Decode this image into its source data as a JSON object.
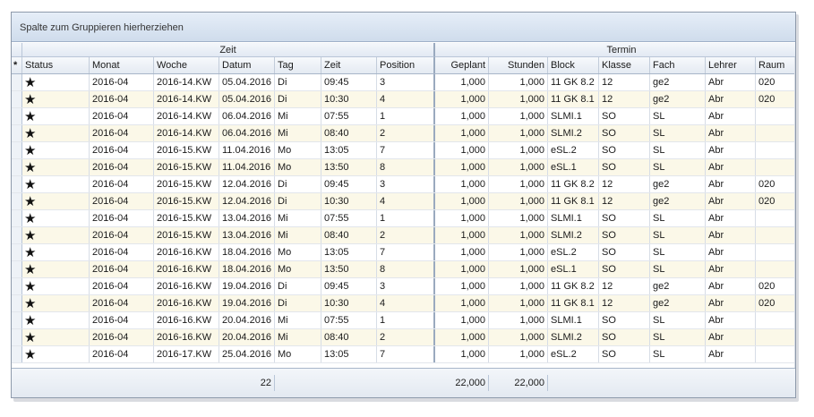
{
  "group_panel": {
    "hint": "Spalte zum Gruppieren hierherziehen"
  },
  "bands": {
    "zeit": "Zeit",
    "termin": "Termin"
  },
  "columns": {
    "indicator": "*",
    "status": "Status",
    "monat": "Monat",
    "woche": "Woche",
    "datum": "Datum",
    "tag": "Tag",
    "zeit": "Zeit",
    "position": "Position",
    "geplant": "Geplant",
    "stunden": "Stunden",
    "block": "Block",
    "klasse": "Klasse",
    "fach": "Fach",
    "lehrer": "Lehrer",
    "raum": "Raum"
  },
  "status_icon": "star-icon",
  "rows": [
    {
      "status": "★",
      "monat": "2016-04",
      "woche": "2016-14.KW",
      "datum": "05.04.2016",
      "tag": "Di",
      "zeit": "09:45",
      "position": "3",
      "geplant": "1,000",
      "stunden": "1,000",
      "block": "11 GK 8.2",
      "klasse": "12",
      "fach": "ge2",
      "lehrer": "Abr",
      "raum": "020"
    },
    {
      "status": "★",
      "monat": "2016-04",
      "woche": "2016-14.KW",
      "datum": "05.04.2016",
      "tag": "Di",
      "zeit": "10:30",
      "position": "4",
      "geplant": "1,000",
      "stunden": "1,000",
      "block": "11 GK 8.1",
      "klasse": "12",
      "fach": "ge2",
      "lehrer": "Abr",
      "raum": "020"
    },
    {
      "status": "★",
      "monat": "2016-04",
      "woche": "2016-14.KW",
      "datum": "06.04.2016",
      "tag": "Mi",
      "zeit": "07:55",
      "position": "1",
      "geplant": "1,000",
      "stunden": "1,000",
      "block": "SLMI.1",
      "klasse": "SO",
      "fach": "SL",
      "lehrer": "Abr",
      "raum": ""
    },
    {
      "status": "★",
      "monat": "2016-04",
      "woche": "2016-14.KW",
      "datum": "06.04.2016",
      "tag": "Mi",
      "zeit": "08:40",
      "position": "2",
      "geplant": "1,000",
      "stunden": "1,000",
      "block": "SLMI.2",
      "klasse": "SO",
      "fach": "SL",
      "lehrer": "Abr",
      "raum": ""
    },
    {
      "status": "★",
      "monat": "2016-04",
      "woche": "2016-15.KW",
      "datum": "11.04.2016",
      "tag": "Mo",
      "zeit": "13:05",
      "position": "7",
      "geplant": "1,000",
      "stunden": "1,000",
      "block": "eSL.2",
      "klasse": "SO",
      "fach": "SL",
      "lehrer": "Abr",
      "raum": ""
    },
    {
      "status": "★",
      "monat": "2016-04",
      "woche": "2016-15.KW",
      "datum": "11.04.2016",
      "tag": "Mo",
      "zeit": "13:50",
      "position": "8",
      "geplant": "1,000",
      "stunden": "1,000",
      "block": "eSL.1",
      "klasse": "SO",
      "fach": "SL",
      "lehrer": "Abr",
      "raum": ""
    },
    {
      "status": "★",
      "monat": "2016-04",
      "woche": "2016-15.KW",
      "datum": "12.04.2016",
      "tag": "Di",
      "zeit": "09:45",
      "position": "3",
      "geplant": "1,000",
      "stunden": "1,000",
      "block": "11 GK 8.2",
      "klasse": "12",
      "fach": "ge2",
      "lehrer": "Abr",
      "raum": "020"
    },
    {
      "status": "★",
      "monat": "2016-04",
      "woche": "2016-15.KW",
      "datum": "12.04.2016",
      "tag": "Di",
      "zeit": "10:30",
      "position": "4",
      "geplant": "1,000",
      "stunden": "1,000",
      "block": "11 GK 8.1",
      "klasse": "12",
      "fach": "ge2",
      "lehrer": "Abr",
      "raum": "020"
    },
    {
      "status": "★",
      "monat": "2016-04",
      "woche": "2016-15.KW",
      "datum": "13.04.2016",
      "tag": "Mi",
      "zeit": "07:55",
      "position": "1",
      "geplant": "1,000",
      "stunden": "1,000",
      "block": "SLMI.1",
      "klasse": "SO",
      "fach": "SL",
      "lehrer": "Abr",
      "raum": ""
    },
    {
      "status": "★",
      "monat": "2016-04",
      "woche": "2016-15.KW",
      "datum": "13.04.2016",
      "tag": "Mi",
      "zeit": "08:40",
      "position": "2",
      "geplant": "1,000",
      "stunden": "1,000",
      "block": "SLMI.2",
      "klasse": "SO",
      "fach": "SL",
      "lehrer": "Abr",
      "raum": ""
    },
    {
      "status": "★",
      "monat": "2016-04",
      "woche": "2016-16.KW",
      "datum": "18.04.2016",
      "tag": "Mo",
      "zeit": "13:05",
      "position": "7",
      "geplant": "1,000",
      "stunden": "1,000",
      "block": "eSL.2",
      "klasse": "SO",
      "fach": "SL",
      "lehrer": "Abr",
      "raum": ""
    },
    {
      "status": "★",
      "monat": "2016-04",
      "woche": "2016-16.KW",
      "datum": "18.04.2016",
      "tag": "Mo",
      "zeit": "13:50",
      "position": "8",
      "geplant": "1,000",
      "stunden": "1,000",
      "block": "eSL.1",
      "klasse": "SO",
      "fach": "SL",
      "lehrer": "Abr",
      "raum": ""
    },
    {
      "status": "★",
      "monat": "2016-04",
      "woche": "2016-16.KW",
      "datum": "19.04.2016",
      "tag": "Di",
      "zeit": "09:45",
      "position": "3",
      "geplant": "1,000",
      "stunden": "1,000",
      "block": "11 GK 8.2",
      "klasse": "12",
      "fach": "ge2",
      "lehrer": "Abr",
      "raum": "020"
    },
    {
      "status": "★",
      "monat": "2016-04",
      "woche": "2016-16.KW",
      "datum": "19.04.2016",
      "tag": "Di",
      "zeit": "10:30",
      "position": "4",
      "geplant": "1,000",
      "stunden": "1,000",
      "block": "11 GK 8.1",
      "klasse": "12",
      "fach": "ge2",
      "lehrer": "Abr",
      "raum": "020"
    },
    {
      "status": "★",
      "monat": "2016-04",
      "woche": "2016-16.KW",
      "datum": "20.04.2016",
      "tag": "Mi",
      "zeit": "07:55",
      "position": "1",
      "geplant": "1,000",
      "stunden": "1,000",
      "block": "SLMI.1",
      "klasse": "SO",
      "fach": "SL",
      "lehrer": "Abr",
      "raum": ""
    },
    {
      "status": "★",
      "monat": "2016-04",
      "woche": "2016-16.KW",
      "datum": "20.04.2016",
      "tag": "Mi",
      "zeit": "08:40",
      "position": "2",
      "geplant": "1,000",
      "stunden": "1,000",
      "block": "SLMI.2",
      "klasse": "SO",
      "fach": "SL",
      "lehrer": "Abr",
      "raum": ""
    },
    {
      "status": "★",
      "monat": "2016-04",
      "woche": "2016-17.KW",
      "datum": "25.04.2016",
      "tag": "Mo",
      "zeit": "13:05",
      "position": "7",
      "geplant": "1,000",
      "stunden": "1,000",
      "block": "eSL.2",
      "klasse": "SO",
      "fach": "SL",
      "lehrer": "Abr",
      "raum": ""
    }
  ],
  "footer": {
    "count": "22",
    "geplant_total": "22,000",
    "stunden_total": "22,000"
  }
}
